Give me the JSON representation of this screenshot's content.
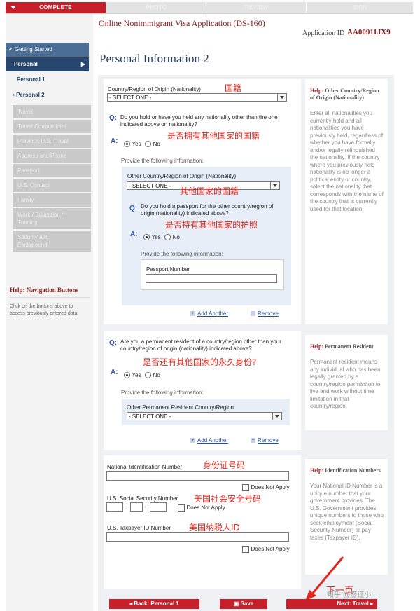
{
  "progress": {
    "steps": [
      "COMPLETE",
      "PHOTO",
      "REVIEW",
      "SIGN"
    ]
  },
  "header": {
    "app_title": "Online Nonimmigrant Visa Application (DS-160)",
    "app_id_label": "Application ID",
    "app_id": "AA00911JX9",
    "page_title": "Personal Information 2"
  },
  "sidebar": {
    "getting_started": "Getting Started",
    "personal": "Personal",
    "sub_items": [
      "Personal 1",
      "Personal 2"
    ],
    "disabled_items": [
      "Travel",
      "Travel Companions",
      "Previous U.S. Travel",
      "Address and Phone",
      "Passport",
      "U.S. Contact",
      "Family"
    ],
    "work_education": [
      "Work / Education /",
      "Training"
    ],
    "security": [
      "Security and",
      "Background"
    ],
    "help_title_prefix": "Help:",
    "help_title": "Navigation Buttons",
    "help_text": "Click on the buttons above to access previously entered data."
  },
  "nationality": {
    "label": "Country/Region of Origin (Nationality)",
    "select_value": "- SELECT ONE -",
    "question": "Do you hold or have you held any nationality other than the one indicated above on nationality?",
    "yes": "Yes",
    "no": "No",
    "provide": "Provide the following information:",
    "other_label": "Other Country/Region of Origin (Nationality)",
    "other_select": "- SELECT ONE -",
    "passport_question": "Do you hold a passport for the other country/region of origin (nationality) indicated above?",
    "provide2": "Provide the following information:",
    "passport_number_label": "Passport Number",
    "add_another": "Add Another",
    "remove": "Remove",
    "help_prefix": "Help:",
    "help_title": "Other Country/Region of Origin (Nationality)",
    "help_text": "Enter all nationalities you currently hold and all nationalities you have previously held, regardless of whether you have formally and/or legally relinquished the nationality. If the country where you previously held nationality is no longer a political entity or country, select the nationality that corresponds with the name of the country that is currently used for that location."
  },
  "residence": {
    "question": "Are you a permanent resident of a country/region other than your country/region of origin (nationality) indicated above?",
    "yes": "Yes",
    "no": "No",
    "provide": "Provide the following information:",
    "other_label": "Other Permanent Resident Country/Region",
    "select_value": "- SELECT ONE -",
    "add_another": "Add Another",
    "remove": "Remove",
    "help_prefix": "Help:",
    "help_title": "Permanent Resident",
    "help_text": "Permanent resident means any individual who has been legally granted by a country/region permission to live and work without time limitation in that country/region."
  },
  "ids": {
    "national_id_label": "National Identification Number",
    "does_not_apply": "Does Not Apply",
    "ssn_label": "U.S. Social Security Number",
    "dash": "-",
    "taxpayer_label": "U.S. Taxpayer ID Number",
    "help_prefix": "Help:",
    "help_title": "Identification Numbers",
    "help_text": "Your National ID Number is a unique number that your government provides. The U.S. Government provides unique numbers to those who seek employment (Social Security Number) or pay taxes (Taxpayer ID)."
  },
  "annotations": {
    "nationality": "国籍",
    "other_nationality": "是否拥有其他国家的国籍",
    "other_country": "其他国家的国籍",
    "other_passport": "是否持有其他国家的护照",
    "permanent_resident": "是否还有其他国家的永久身份?",
    "national_id": "身份证号码",
    "ssn": "美国社会安全号码",
    "taxpayer": "美国纳税人ID",
    "next_page": "下一页"
  },
  "watermark": "知乎 @签证小J",
  "footer": {
    "back": "Back: Personal 1",
    "save": "Save",
    "next": "Next: Travel"
  }
}
